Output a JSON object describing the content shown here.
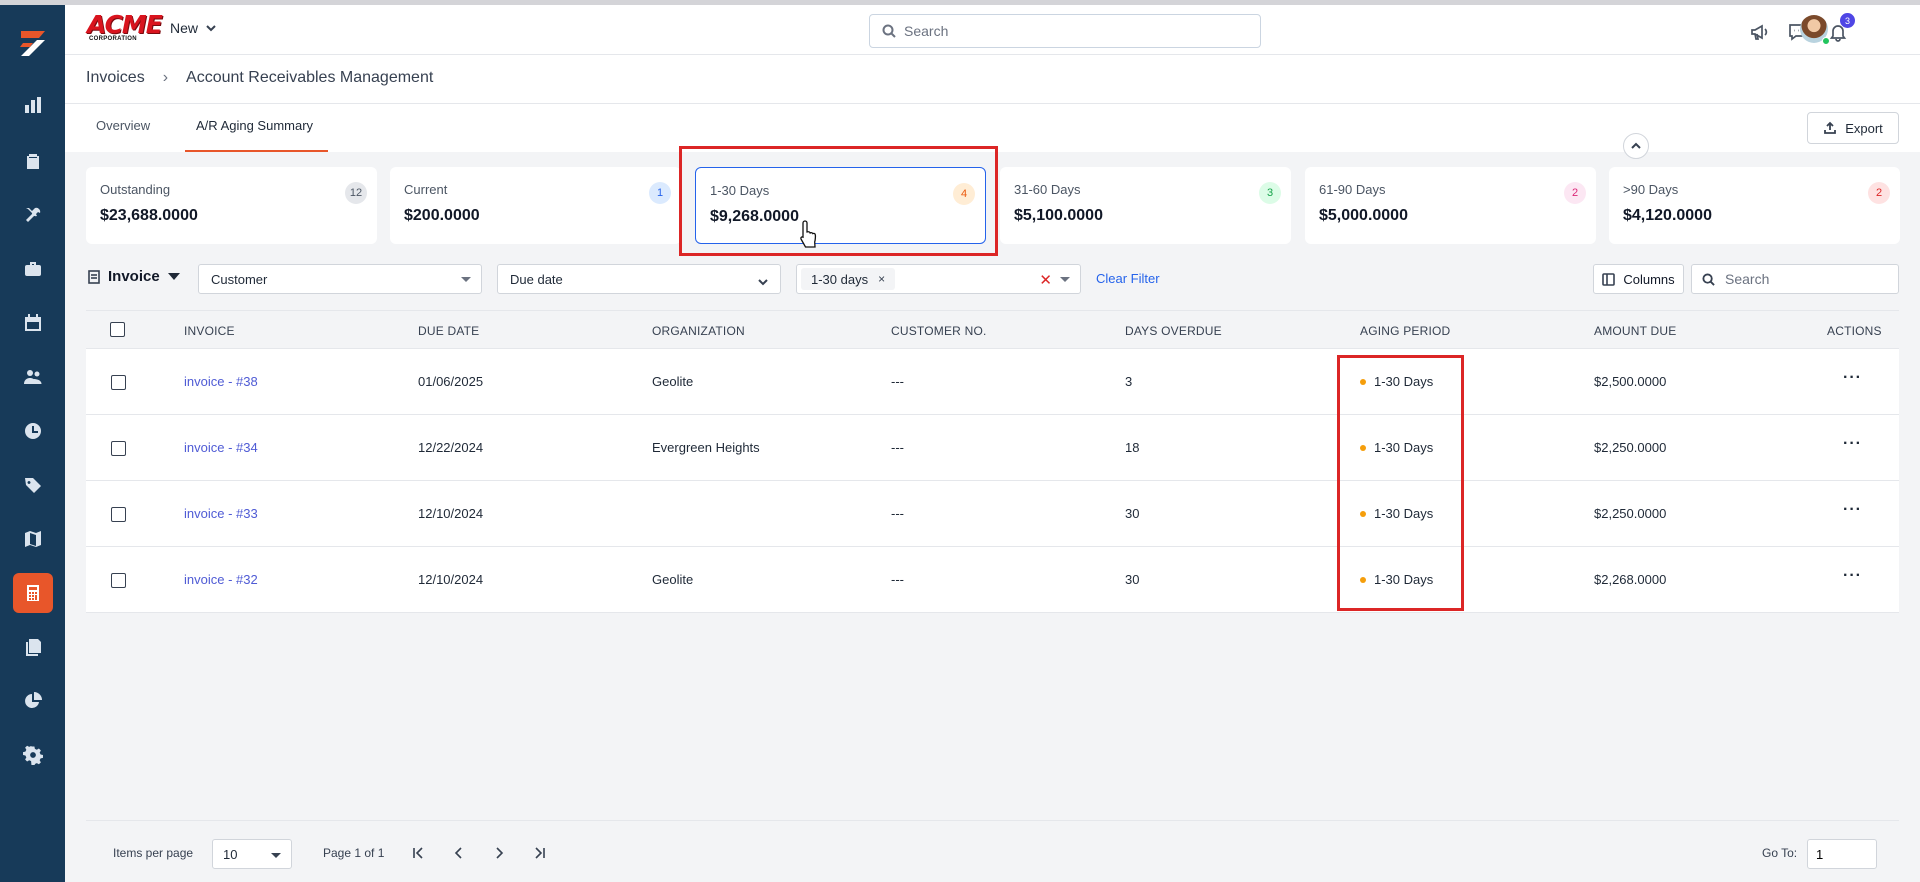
{
  "brand": {
    "name_top": "ACME",
    "name_bottom": "CORPORATION"
  },
  "header": {
    "new_label": "New",
    "search_placeholder": "Search",
    "notifications_count": "3"
  },
  "breadcrumb": {
    "root": "Invoices",
    "current": "Account Receivables Management"
  },
  "tabs": [
    {
      "label": "Overview",
      "active": false
    },
    {
      "label": "A/R Aging Summary",
      "active": true
    }
  ],
  "export_label": "Export",
  "cards": [
    {
      "label": "Outstanding",
      "value": "$23,688.0000",
      "count": "12",
      "badge_bg": "#e5e7eb",
      "badge_fg": "#4b5563"
    },
    {
      "label": "Current",
      "value": "$200.0000",
      "count": "1",
      "badge_bg": "#dbeafe",
      "badge_fg": "#2563eb"
    },
    {
      "label": "1-30 Days",
      "value": "$9,268.0000",
      "count": "4",
      "badge_bg": "#ffedd5",
      "badge_fg": "#ea580c"
    },
    {
      "label": "31-60 Days",
      "value": "$5,100.0000",
      "count": "3",
      "badge_bg": "#dcfce7",
      "badge_fg": "#16a34a"
    },
    {
      "label": "61-90 Days",
      "value": "$5,000.0000",
      "count": "2",
      "badge_bg": "#fce7f3",
      "badge_fg": "#db2777"
    },
    {
      "label": ">90 Days",
      "value": "$4,120.0000",
      "count": "2",
      "badge_bg": "#fee2e2",
      "badge_fg": "#dc2626"
    }
  ],
  "filters": {
    "type_label": "Invoice",
    "customer_label": "Customer",
    "due_date_label": "Due date",
    "aging_chip": "1-30 days",
    "chip_remove": "×",
    "clear_all": "✕",
    "clear_filter_label": "Clear Filter",
    "columns_label": "Columns",
    "search_placeholder": "Search"
  },
  "table": {
    "headers": [
      "INVOICE",
      "DUE DATE",
      "ORGANIZATION",
      "CUSTOMER NO.",
      "DAYS OVERDUE",
      "AGING PERIOD",
      "AMOUNT DUE",
      "ACTIONS"
    ],
    "rows": [
      {
        "invoice": "invoice - #38",
        "due_date": "01/06/2025",
        "organization": "Geolite",
        "customer_no": "---",
        "days_overdue": "3",
        "aging": "1-30 Days",
        "amount": "$2,500.0000",
        "actions": "···"
      },
      {
        "invoice": "invoice - #34",
        "due_date": "12/22/2024",
        "organization": "Evergreen Heights",
        "customer_no": "---",
        "days_overdue": "18",
        "aging": "1-30 Days",
        "amount": "$2,250.0000",
        "actions": "···"
      },
      {
        "invoice": "invoice - #33",
        "due_date": "12/10/2024",
        "organization": "",
        "customer_no": "---",
        "days_overdue": "30",
        "aging": "1-30 Days",
        "amount": "$2,250.0000",
        "actions": "···"
      },
      {
        "invoice": "invoice - #32",
        "due_date": "12/10/2024",
        "organization": "Geolite",
        "customer_no": "---",
        "days_overdue": "30",
        "aging": "1-30 Days",
        "amount": "$2,268.0000",
        "actions": "···"
      }
    ]
  },
  "pagination": {
    "items_per_page_label": "Items per page",
    "items_per_page": "10",
    "page_info": "Page 1 of 1",
    "goto_label": "Go To:",
    "goto_value": "1"
  },
  "colors": {
    "sidebar": "#173a59",
    "accent": "#e8562a",
    "link": "#4f5bd5",
    "highlight": "#dc2626"
  }
}
